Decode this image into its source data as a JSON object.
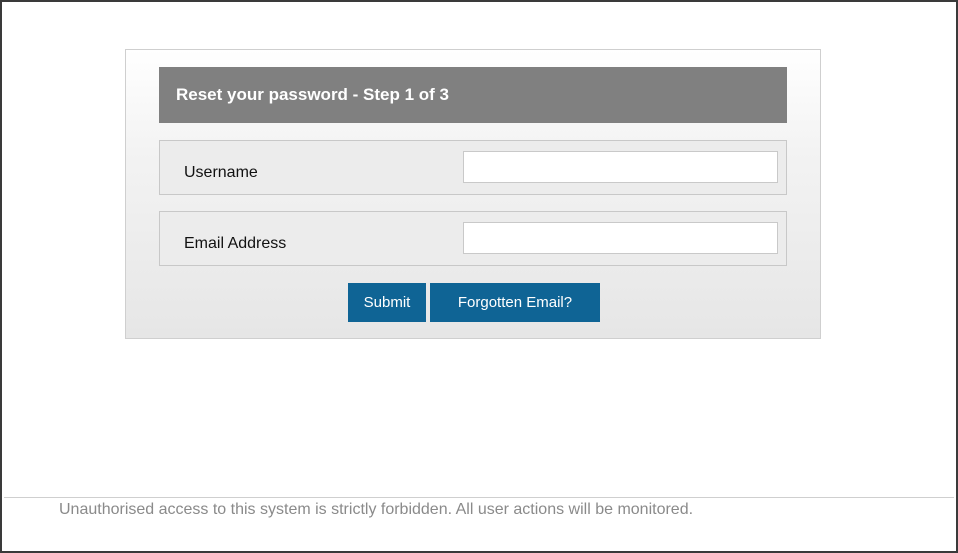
{
  "form": {
    "title": "Reset your password - Step 1 of 3",
    "username": {
      "label": "Username",
      "value": "",
      "placeholder": ""
    },
    "email": {
      "label": "Email Address",
      "value": "",
      "placeholder": ""
    },
    "buttons": {
      "submit": "Submit",
      "forgotten_email": "Forgotten Email?"
    }
  },
  "footer": {
    "notice": "Unauthorised access to this system is strictly forbidden. All user actions will be monitored."
  },
  "colors": {
    "header_bg": "#808080",
    "button_bg": "#0f6495",
    "footer_text": "#8a8a8a"
  }
}
